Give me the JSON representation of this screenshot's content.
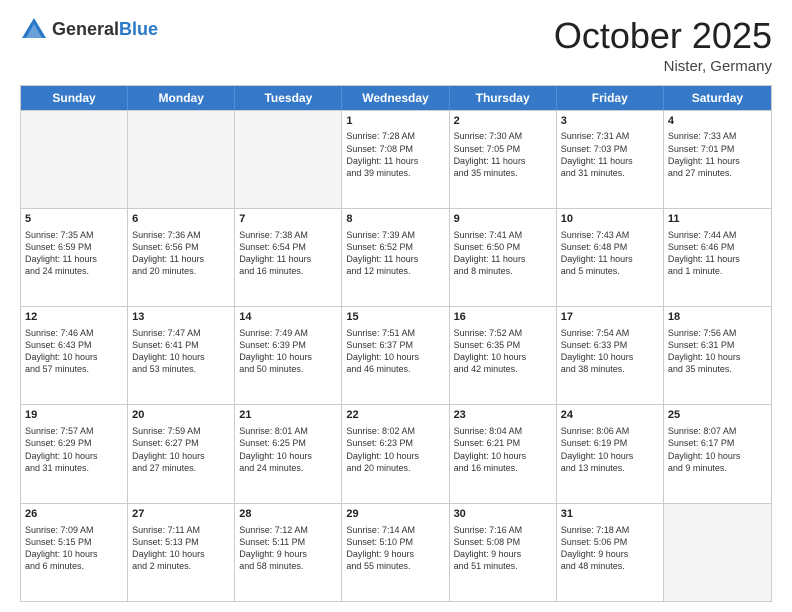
{
  "header": {
    "logo_general": "General",
    "logo_blue": "Blue",
    "month_title": "October 2025",
    "location": "Nister, Germany"
  },
  "days_of_week": [
    "Sunday",
    "Monday",
    "Tuesday",
    "Wednesday",
    "Thursday",
    "Friday",
    "Saturday"
  ],
  "weeks": [
    [
      {
        "day": "",
        "empty": true
      },
      {
        "day": "",
        "empty": true
      },
      {
        "day": "",
        "empty": true
      },
      {
        "day": "1",
        "lines": [
          "Sunrise: 7:28 AM",
          "Sunset: 7:08 PM",
          "Daylight: 11 hours",
          "and 39 minutes."
        ]
      },
      {
        "day": "2",
        "lines": [
          "Sunrise: 7:30 AM",
          "Sunset: 7:05 PM",
          "Daylight: 11 hours",
          "and 35 minutes."
        ]
      },
      {
        "day": "3",
        "lines": [
          "Sunrise: 7:31 AM",
          "Sunset: 7:03 PM",
          "Daylight: 11 hours",
          "and 31 minutes."
        ]
      },
      {
        "day": "4",
        "lines": [
          "Sunrise: 7:33 AM",
          "Sunset: 7:01 PM",
          "Daylight: 11 hours",
          "and 27 minutes."
        ]
      }
    ],
    [
      {
        "day": "5",
        "lines": [
          "Sunrise: 7:35 AM",
          "Sunset: 6:59 PM",
          "Daylight: 11 hours",
          "and 24 minutes."
        ]
      },
      {
        "day": "6",
        "lines": [
          "Sunrise: 7:36 AM",
          "Sunset: 6:56 PM",
          "Daylight: 11 hours",
          "and 20 minutes."
        ]
      },
      {
        "day": "7",
        "lines": [
          "Sunrise: 7:38 AM",
          "Sunset: 6:54 PM",
          "Daylight: 11 hours",
          "and 16 minutes."
        ]
      },
      {
        "day": "8",
        "lines": [
          "Sunrise: 7:39 AM",
          "Sunset: 6:52 PM",
          "Daylight: 11 hours",
          "and 12 minutes."
        ]
      },
      {
        "day": "9",
        "lines": [
          "Sunrise: 7:41 AM",
          "Sunset: 6:50 PM",
          "Daylight: 11 hours",
          "and 8 minutes."
        ]
      },
      {
        "day": "10",
        "lines": [
          "Sunrise: 7:43 AM",
          "Sunset: 6:48 PM",
          "Daylight: 11 hours",
          "and 5 minutes."
        ]
      },
      {
        "day": "11",
        "lines": [
          "Sunrise: 7:44 AM",
          "Sunset: 6:46 PM",
          "Daylight: 11 hours",
          "and 1 minute."
        ]
      }
    ],
    [
      {
        "day": "12",
        "lines": [
          "Sunrise: 7:46 AM",
          "Sunset: 6:43 PM",
          "Daylight: 10 hours",
          "and 57 minutes."
        ]
      },
      {
        "day": "13",
        "lines": [
          "Sunrise: 7:47 AM",
          "Sunset: 6:41 PM",
          "Daylight: 10 hours",
          "and 53 minutes."
        ]
      },
      {
        "day": "14",
        "lines": [
          "Sunrise: 7:49 AM",
          "Sunset: 6:39 PM",
          "Daylight: 10 hours",
          "and 50 minutes."
        ]
      },
      {
        "day": "15",
        "lines": [
          "Sunrise: 7:51 AM",
          "Sunset: 6:37 PM",
          "Daylight: 10 hours",
          "and 46 minutes."
        ]
      },
      {
        "day": "16",
        "lines": [
          "Sunrise: 7:52 AM",
          "Sunset: 6:35 PM",
          "Daylight: 10 hours",
          "and 42 minutes."
        ]
      },
      {
        "day": "17",
        "lines": [
          "Sunrise: 7:54 AM",
          "Sunset: 6:33 PM",
          "Daylight: 10 hours",
          "and 38 minutes."
        ]
      },
      {
        "day": "18",
        "lines": [
          "Sunrise: 7:56 AM",
          "Sunset: 6:31 PM",
          "Daylight: 10 hours",
          "and 35 minutes."
        ]
      }
    ],
    [
      {
        "day": "19",
        "lines": [
          "Sunrise: 7:57 AM",
          "Sunset: 6:29 PM",
          "Daylight: 10 hours",
          "and 31 minutes."
        ]
      },
      {
        "day": "20",
        "lines": [
          "Sunrise: 7:59 AM",
          "Sunset: 6:27 PM",
          "Daylight: 10 hours",
          "and 27 minutes."
        ]
      },
      {
        "day": "21",
        "lines": [
          "Sunrise: 8:01 AM",
          "Sunset: 6:25 PM",
          "Daylight: 10 hours",
          "and 24 minutes."
        ]
      },
      {
        "day": "22",
        "lines": [
          "Sunrise: 8:02 AM",
          "Sunset: 6:23 PM",
          "Daylight: 10 hours",
          "and 20 minutes."
        ]
      },
      {
        "day": "23",
        "lines": [
          "Sunrise: 8:04 AM",
          "Sunset: 6:21 PM",
          "Daylight: 10 hours",
          "and 16 minutes."
        ]
      },
      {
        "day": "24",
        "lines": [
          "Sunrise: 8:06 AM",
          "Sunset: 6:19 PM",
          "Daylight: 10 hours",
          "and 13 minutes."
        ]
      },
      {
        "day": "25",
        "lines": [
          "Sunrise: 8:07 AM",
          "Sunset: 6:17 PM",
          "Daylight: 10 hours",
          "and 9 minutes."
        ]
      }
    ],
    [
      {
        "day": "26",
        "lines": [
          "Sunrise: 7:09 AM",
          "Sunset: 5:15 PM",
          "Daylight: 10 hours",
          "and 6 minutes."
        ]
      },
      {
        "day": "27",
        "lines": [
          "Sunrise: 7:11 AM",
          "Sunset: 5:13 PM",
          "Daylight: 10 hours",
          "and 2 minutes."
        ]
      },
      {
        "day": "28",
        "lines": [
          "Sunrise: 7:12 AM",
          "Sunset: 5:11 PM",
          "Daylight: 9 hours",
          "and 58 minutes."
        ]
      },
      {
        "day": "29",
        "lines": [
          "Sunrise: 7:14 AM",
          "Sunset: 5:10 PM",
          "Daylight: 9 hours",
          "and 55 minutes."
        ]
      },
      {
        "day": "30",
        "lines": [
          "Sunrise: 7:16 AM",
          "Sunset: 5:08 PM",
          "Daylight: 9 hours",
          "and 51 minutes."
        ]
      },
      {
        "day": "31",
        "lines": [
          "Sunrise: 7:18 AM",
          "Sunset: 5:06 PM",
          "Daylight: 9 hours",
          "and 48 minutes."
        ]
      },
      {
        "day": "",
        "empty": true
      }
    ]
  ]
}
